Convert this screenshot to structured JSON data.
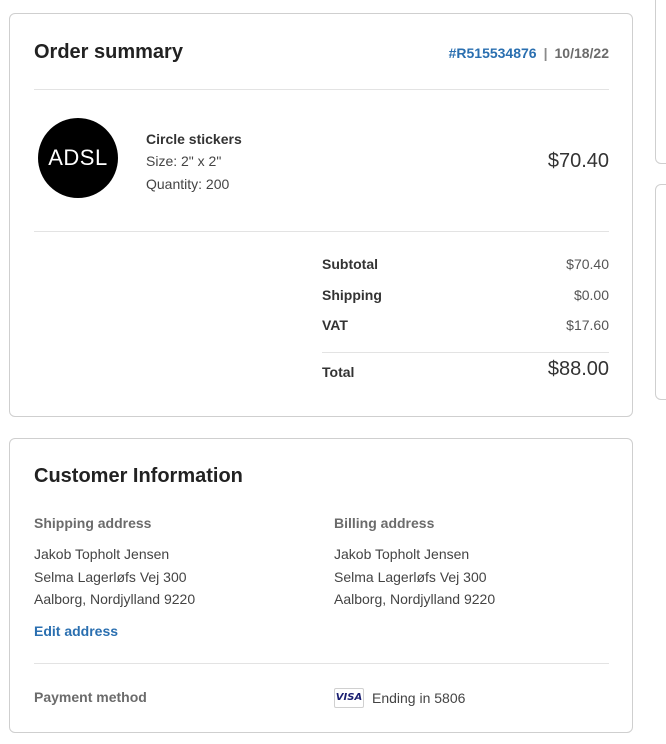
{
  "order_summary": {
    "title": "Order summary",
    "order_number": "#R515534876",
    "separator": "|",
    "date": "10/18/22",
    "item": {
      "logo_text": "ADSL",
      "name": "Circle stickers",
      "size": "Size: 2\" x 2\"",
      "quantity": "Quantity: 200",
      "price": "$70.40"
    },
    "totals": {
      "subtotal_label": "Subtotal",
      "subtotal_value": "$70.40",
      "shipping_label": "Shipping",
      "shipping_value": "$0.00",
      "vat_label": "VAT",
      "vat_value": "$17.60",
      "total_label": "Total",
      "total_value": "$88.00"
    }
  },
  "customer_info": {
    "title": "Customer Information",
    "shipping": {
      "heading": "Shipping address",
      "name": "Jakob Topholt Jensen",
      "street": "Selma Lagerløfs Vej 300",
      "city": "Aalborg, Nordjylland 9220"
    },
    "billing": {
      "heading": "Billing address",
      "name": "Jakob Topholt Jensen",
      "street": "Selma Lagerløfs Vej 300",
      "city": "Aalborg, Nordjylland 9220"
    },
    "edit_address_label": "Edit address",
    "payment": {
      "label": "Payment method",
      "card_brand": "VISA",
      "ending_text": "Ending in 5806"
    }
  },
  "colors": {
    "link_blue": "#2a6fb0",
    "logo_background": "#000000",
    "visa_navy": "#1a1f71"
  }
}
